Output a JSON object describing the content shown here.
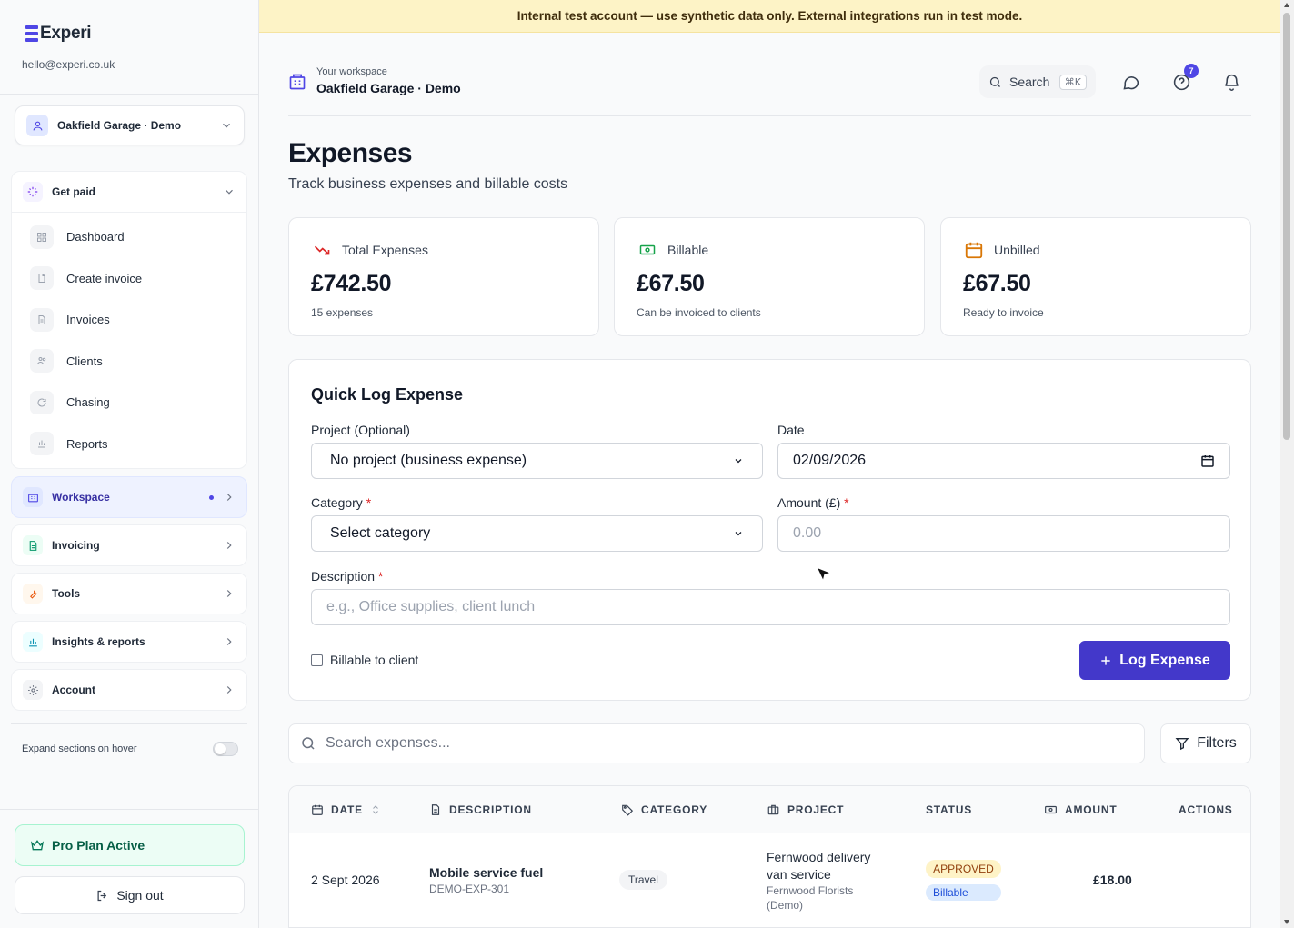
{
  "banner": {
    "text": "Internal test account — use synthetic data only. External integrations run in test mode."
  },
  "brand": {
    "name": "Experi",
    "email": "hello@experi.co.uk",
    "color": "#4f46e5"
  },
  "workspace_selector": {
    "name": "Oakfield Garage · Demo"
  },
  "nav": {
    "get_paid": {
      "label": "Get paid",
      "items": [
        {
          "label": "Dashboard",
          "icon": "grid-icon"
        },
        {
          "label": "Create invoice",
          "icon": "file-plus-icon"
        },
        {
          "label": "Invoices",
          "icon": "file-text-icon"
        },
        {
          "label": "Clients",
          "icon": "users-icon"
        },
        {
          "label": "Chasing",
          "icon": "refresh-icon"
        },
        {
          "label": "Reports",
          "icon": "bar-chart-icon"
        }
      ]
    },
    "sections": [
      {
        "label": "Workspace",
        "icon": "building-icon",
        "active": true
      },
      {
        "label": "Invoicing",
        "icon": "document-icon"
      },
      {
        "label": "Tools",
        "icon": "wrench-icon"
      },
      {
        "label": "Insights & reports",
        "icon": "chart-icon"
      },
      {
        "label": "Account",
        "icon": "gear-icon"
      }
    ]
  },
  "expand_on_hover": {
    "label": "Expand sections on hover",
    "enabled": false
  },
  "plan": {
    "label": "Pro Plan Active"
  },
  "signout": {
    "label": "Sign out"
  },
  "header": {
    "workspace_caption": "Your workspace",
    "workspace_name": "Oakfield Garage · Demo",
    "search_label": "Search",
    "search_shortcut": "⌘K",
    "help_badge": "7"
  },
  "page": {
    "title": "Expenses",
    "subtitle": "Track business expenses and billable costs"
  },
  "stats": [
    {
      "label": "Total Expenses",
      "value": "£742.50",
      "sub": "15 expenses",
      "icon": "trending-down-icon",
      "color": "#dc2626"
    },
    {
      "label": "Billable",
      "value": "£67.50",
      "sub": "Can be invoiced to clients",
      "icon": "banknote-icon",
      "color": "#16a34a"
    },
    {
      "label": "Unbilled",
      "value": "£67.50",
      "sub": "Ready to invoice",
      "icon": "calendar-icon",
      "color": "#d97706"
    }
  ],
  "quick_log": {
    "title": "Quick Log Expense",
    "project_label": "Project (Optional)",
    "project_value": "No project (business expense)",
    "date_label": "Date",
    "date_value": "02/09/2026",
    "category_label": "Category",
    "category_value": "Select category",
    "amount_label": "Amount (£)",
    "amount_placeholder": "0.00",
    "description_label": "Description",
    "description_placeholder": "e.g., Office supplies, client lunch",
    "billable_label": "Billable to client",
    "submit_label": "Log Expense",
    "required_mark": "*"
  },
  "list": {
    "search_placeholder": "Search expenses...",
    "filters_label": "Filters",
    "columns": [
      "DATE",
      "DESCRIPTION",
      "CATEGORY",
      "PROJECT",
      "STATUS",
      "AMOUNT",
      "ACTIONS"
    ],
    "rows": [
      {
        "date": "2 Sept 2026",
        "description": "Mobile service fuel",
        "ref": "DEMO-EXP-301",
        "category": "Travel",
        "project_line1": "Fernwood delivery",
        "project_line2": "van service",
        "client_line1": "Fernwood Florists",
        "client_line2": "(Demo)",
        "status": "APPROVED",
        "billable": "Billable",
        "amount": "£18.00"
      }
    ]
  }
}
